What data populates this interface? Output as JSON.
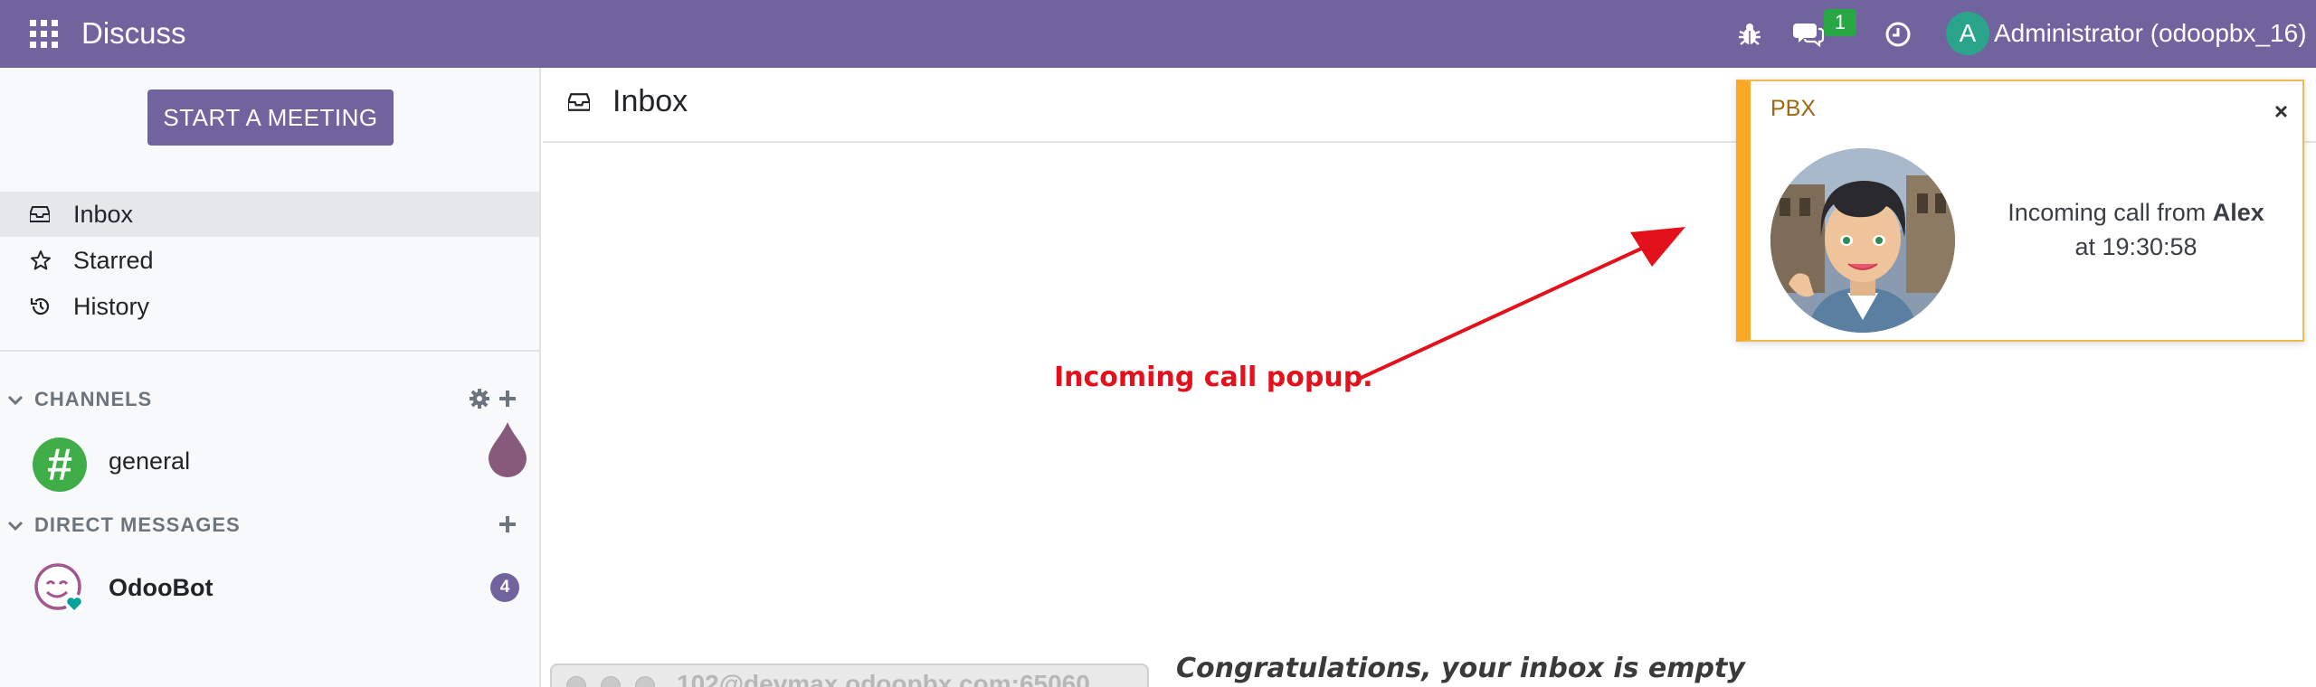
{
  "navbar": {
    "app_title": "Discuss",
    "message_count": "1",
    "user_initial": "A",
    "user_name": "Administrator (odoopbx_16)",
    "bg_color": "#71639e"
  },
  "sidebar": {
    "start_meeting_label": "START A MEETING",
    "mailboxes": [
      {
        "label": "Inbox",
        "icon": "inbox-icon",
        "active": true
      },
      {
        "label": "Starred",
        "icon": "star-icon",
        "active": false
      },
      {
        "label": "History",
        "icon": "history-icon",
        "active": false
      }
    ],
    "channels_header": "CHANNELS",
    "channels": [
      {
        "name": "general",
        "icon": "hash-icon"
      }
    ],
    "dm_header": "DIRECT MESSAGES",
    "direct_messages": [
      {
        "name": "OdooBot",
        "unread": "4"
      }
    ]
  },
  "main": {
    "title": "Inbox",
    "annotation": "Incoming call popup.",
    "empty_message": "Congratulations, your inbox is empty"
  },
  "softphone": {
    "account": "102@devmax.odoopbx.com:65060"
  },
  "call_popup": {
    "title": "PBX",
    "close_label": "×",
    "line1_prefix": "Incoming call from ",
    "caller": "Alex",
    "line2": "at 19:30:58",
    "accent_color": "#f9a825"
  }
}
